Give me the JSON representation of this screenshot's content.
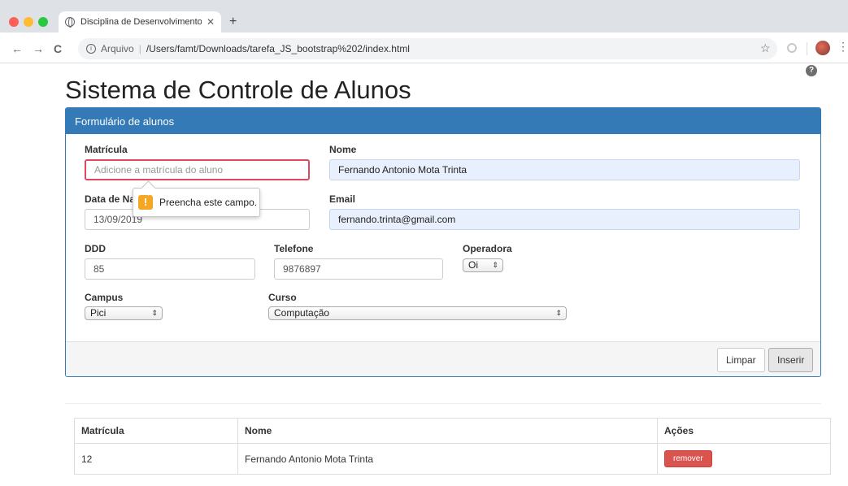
{
  "browser": {
    "tab_title": "Disciplina de Desenvolvimento",
    "tab_close": "✕",
    "new_tab": "+",
    "back": "←",
    "forward": "→",
    "reload": "C",
    "address_scheme": "Arquivo",
    "address_path": "/Users/famt/Downloads/tarefa_JS_bootstrap%202/index.html",
    "bookmark_star": "☆",
    "menu": "⋮"
  },
  "page": {
    "title": "Sistema de Controle de Alunos",
    "help_glyph": "?"
  },
  "form": {
    "heading": "Formulário de alunos",
    "matricula": {
      "label": "Matrícula",
      "value": "",
      "placeholder": "Adicione a matrícula do aluno"
    },
    "nome": {
      "label": "Nome",
      "value": "Fernando Antonio Mota Trinta"
    },
    "data_nascimento": {
      "label": "Data de Na",
      "value": "13/09/2019"
    },
    "email": {
      "label": "Email",
      "value": "fernando.trinta@gmail.com"
    },
    "ddd": {
      "label": "DDD",
      "value": "85"
    },
    "telefone": {
      "label": "Telefone",
      "value": "9876897"
    },
    "operadora": {
      "label": "Operadora",
      "selected": "Oi"
    },
    "campus": {
      "label": "Campus",
      "selected": "Pici"
    },
    "curso": {
      "label": "Curso",
      "selected": "Computação"
    },
    "validation_message": "Preencha este campo.",
    "limpar_label": "Limpar",
    "inserir_label": "Inserir"
  },
  "table": {
    "headers": [
      "Matrícula",
      "Nome",
      "Ações"
    ],
    "rows": [
      {
        "matricula": "12",
        "nome": "Fernando Antonio Mota Trinta",
        "action": "remover"
      }
    ]
  },
  "colors": {
    "primary": "#337ab7",
    "danger": "#d9534f",
    "invalid_border": "#e0475f",
    "warning": "#f5a623"
  }
}
